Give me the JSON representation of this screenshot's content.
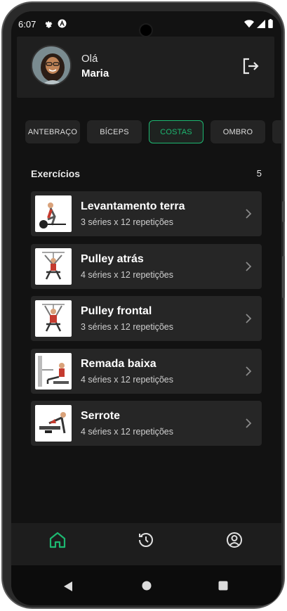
{
  "status": {
    "time": "6:07"
  },
  "header": {
    "greeting": "Olá",
    "username": "Maria"
  },
  "tabs": [
    {
      "label": "ANTEBRAÇO",
      "active": false
    },
    {
      "label": "BÍCEPS",
      "active": false
    },
    {
      "label": "COSTAS",
      "active": true
    },
    {
      "label": "OMBRO",
      "active": false
    }
  ],
  "section": {
    "title": "Exercícios",
    "count": "5"
  },
  "exercises": [
    {
      "name": "Levantamento terra",
      "detail": "3 séries x 12 repetições"
    },
    {
      "name": "Pulley atrás",
      "detail": "4 séries x 12 repetições"
    },
    {
      "name": "Pulley frontal",
      "detail": "3 séries x 12 repetições"
    },
    {
      "name": "Remada baixa",
      "detail": "4 séries x 12 repetições"
    },
    {
      "name": "Serrote",
      "detail": "4 séries x 12 repetições"
    }
  ],
  "icons": {
    "logout": "logout-icon",
    "home": "home-icon",
    "history": "history-icon",
    "profile": "profile-icon",
    "chevron": "chevron-right-icon",
    "back": "back-triangle-icon",
    "homeSys": "home-circle-icon",
    "recents": "recents-square-icon"
  },
  "colors": {
    "accent": "#1db871",
    "background": "#121212",
    "card": "#262626"
  }
}
